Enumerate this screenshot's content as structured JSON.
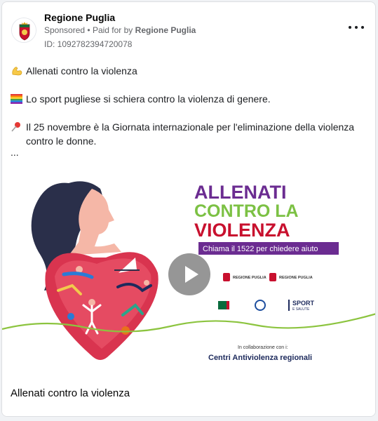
{
  "post": {
    "page_name": "Regione Puglia",
    "sponsored": "Sponsored",
    "separator": "•",
    "paid_for_prefix": "Paid for by",
    "paid_for_by": "Regione Puglia",
    "ad_id": "ID: 1092782394720078",
    "more_icon": "more-horizontal-icon"
  },
  "body": {
    "line1": "Allenati contro la violenza",
    "line2": "Lo sport pugliese si schiera contro la violenza di genere.",
    "line3": "Il 25 novembre è la Giornata internazionale per l'eliminazione della violenza contro le donne.",
    "ellipsis": "..."
  },
  "media": {
    "headline_1": "ALLENATI",
    "headline_2": "CONTRO LA",
    "headline_3": "VIOLENZA",
    "call_banner": "Chiama il 1522 per chiedere aiuto",
    "logo_text_1": "REGIONE PUGLIA",
    "logo_text_2": "REGIONE PUGLIA",
    "sport_logo": "SPORT",
    "sport_logo_sub": "E SALUTE",
    "collab_label": "In collaborazione con i:",
    "collab_name": "Centri Antiviolenza regionali",
    "play_icon": "play-icon"
  },
  "footer": {
    "title": "Allenati contro la violenza"
  },
  "colors": {
    "purple": "#6b2c91",
    "green": "#7cc144",
    "red": "#e63547",
    "navy": "#1d2a5c"
  }
}
